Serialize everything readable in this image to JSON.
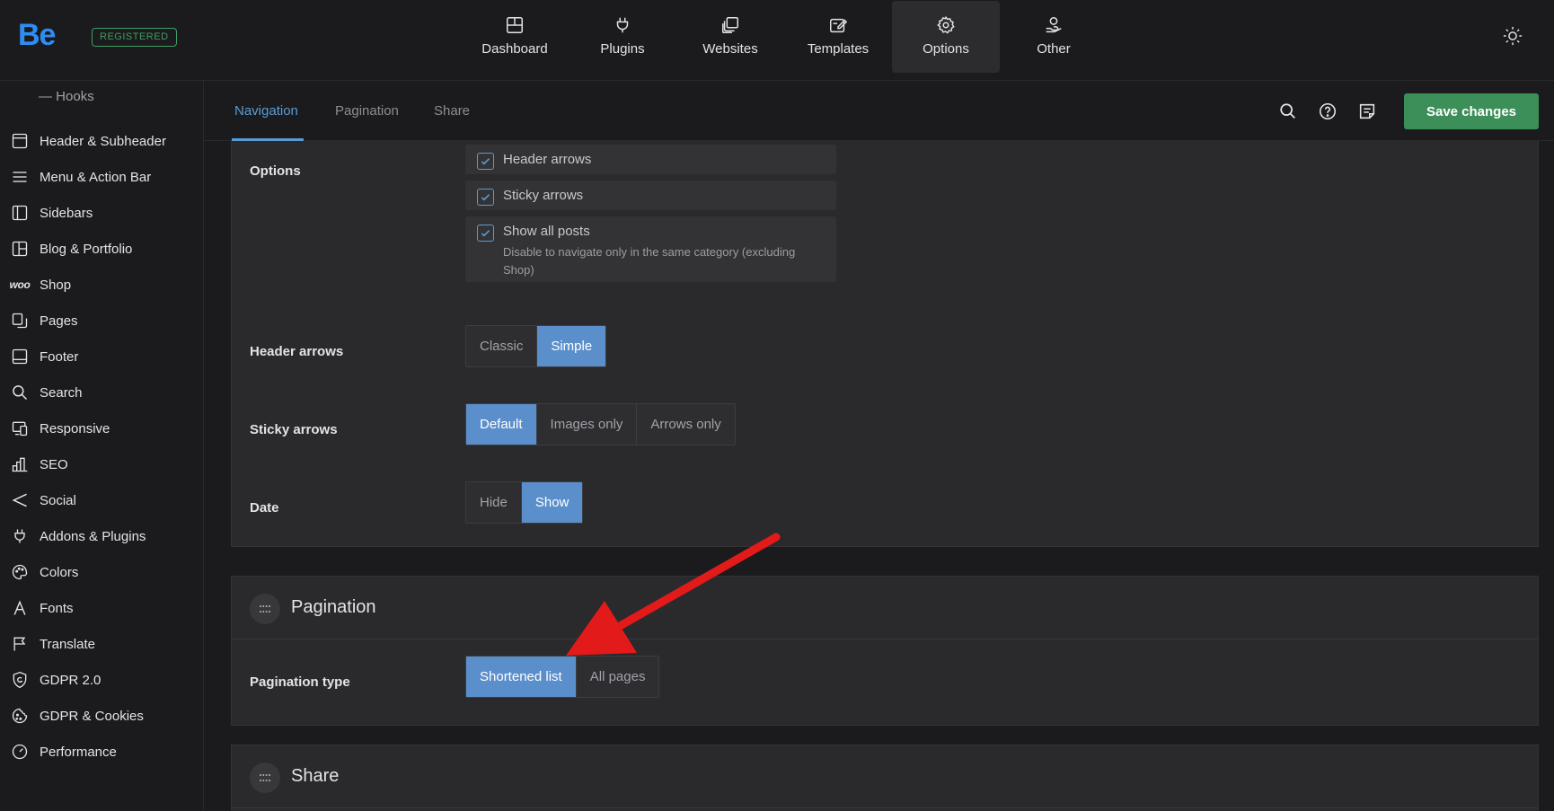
{
  "brand": {
    "logo": "Be",
    "badge": "REGISTERED"
  },
  "topnav": [
    {
      "label": "Dashboard",
      "icon": "dashboard-icon"
    },
    {
      "label": "Plugins",
      "icon": "plug-icon"
    },
    {
      "label": "Websites",
      "icon": "websites-icon"
    },
    {
      "label": "Templates",
      "icon": "templates-icon"
    },
    {
      "label": "Options",
      "icon": "gear-icon",
      "active": true
    },
    {
      "label": "Other",
      "icon": "user-hand-icon"
    }
  ],
  "sidebar": {
    "sub_item": "Hooks",
    "items": [
      {
        "label": "Header & Subheader",
        "icon": "header-icon"
      },
      {
        "label": "Menu & Action Bar",
        "icon": "menu-icon"
      },
      {
        "label": "Sidebars",
        "icon": "sidebar-icon"
      },
      {
        "label": "Blog & Portfolio",
        "icon": "grid-icon"
      },
      {
        "label": "Shop",
        "icon": "woo-icon",
        "icon_text": "woo"
      },
      {
        "label": "Pages",
        "icon": "pages-icon"
      },
      {
        "label": "Footer",
        "icon": "footer-icon"
      },
      {
        "label": "Search",
        "icon": "search-icon"
      },
      {
        "label": "Responsive",
        "icon": "responsive-icon"
      },
      {
        "label": "SEO",
        "icon": "chart-icon"
      },
      {
        "label": "Social",
        "icon": "share-icon"
      },
      {
        "label": "Addons & Plugins",
        "icon": "plug-icon"
      },
      {
        "label": "Colors",
        "icon": "palette-icon"
      },
      {
        "label": "Fonts",
        "icon": "font-icon"
      },
      {
        "label": "Translate",
        "icon": "flag-icon"
      },
      {
        "label": "GDPR 2.0",
        "icon": "shield-icon"
      },
      {
        "label": "GDPR & Cookies",
        "icon": "cookie-icon"
      },
      {
        "label": "Performance",
        "icon": "gauge-icon"
      }
    ]
  },
  "subheader": {
    "tabs": [
      "Navigation",
      "Pagination",
      "Share"
    ],
    "active_tab": "Navigation",
    "save_label": "Save changes"
  },
  "navigation": {
    "options_label": "Options",
    "checkboxes": [
      {
        "label": "Header arrows",
        "checked": true
      },
      {
        "label": "Sticky arrows",
        "checked": true
      },
      {
        "label": "Show all posts",
        "checked": true,
        "description": "Disable to navigate only in the same category (excluding Shop)"
      }
    ],
    "header_arrows": {
      "label": "Header arrows",
      "options": [
        "Classic",
        "Simple"
      ],
      "selected": "Simple"
    },
    "sticky_arrows": {
      "label": "Sticky arrows",
      "options": [
        "Default",
        "Images only",
        "Arrows only"
      ],
      "selected": "Default"
    },
    "date": {
      "label": "Date",
      "options": [
        "Hide",
        "Show"
      ],
      "selected": "Show"
    }
  },
  "pagination": {
    "title": "Pagination",
    "type": {
      "label": "Pagination type",
      "options": [
        "Shortened list",
        "All pages"
      ],
      "selected": "Shortened list"
    }
  },
  "share": {
    "title": "Share"
  },
  "colors": {
    "accent": "#5b8fcb",
    "save": "#3d8f5a",
    "brand": "#2d8df2",
    "annotation_arrow": "#e21a1a"
  }
}
